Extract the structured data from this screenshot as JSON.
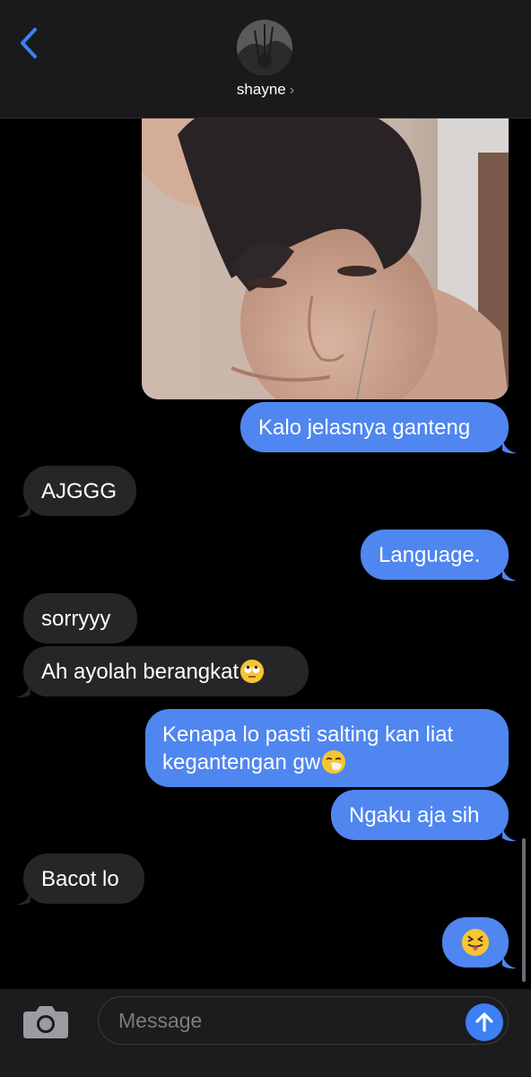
{
  "header": {
    "contact_name": "shayne",
    "chevron": "›"
  },
  "messages": [
    {
      "from": "me",
      "text": "Kalo jelasnya ganteng"
    },
    {
      "from": "them",
      "text": "AJGGG"
    },
    {
      "from": "me",
      "text": "Language."
    },
    {
      "from": "them",
      "text": "sorryyy"
    },
    {
      "from": "them",
      "text": "Ah ayolah berangkat",
      "emoji": "face-with-rolling-eyes"
    },
    {
      "from": "me",
      "text_line1": "Kenapa lo pasti salting kan liat",
      "text_line2": "kegantengan gw",
      "emoji": "sneezing-face"
    },
    {
      "from": "me",
      "text": "Ngaku aja sih"
    },
    {
      "from": "them",
      "text": "Bacot lo"
    },
    {
      "from": "me",
      "emoji": "squinting-face-with-tongue"
    }
  ],
  "composer": {
    "placeholder": "Message"
  },
  "colors": {
    "outgoing_bubble": "#4f86f0",
    "incoming_bubble": "#262629",
    "accent": "#3d7ff4",
    "background": "#000000"
  },
  "icons": [
    "back-chevron-icon",
    "camera-icon",
    "send-arrow-icon"
  ]
}
